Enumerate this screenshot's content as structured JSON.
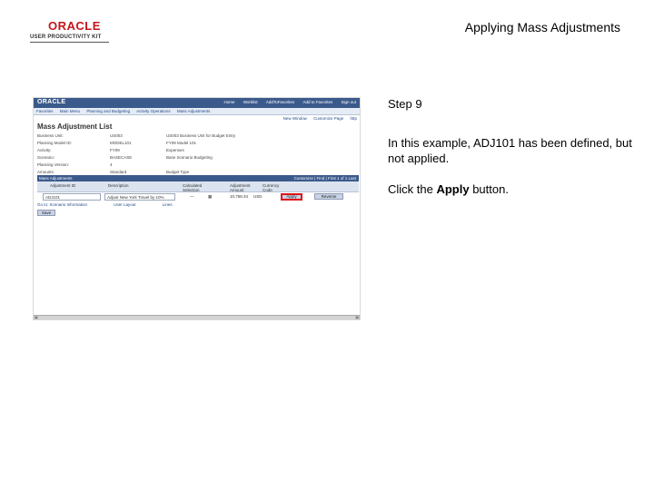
{
  "header": {
    "logo_oracle": "ORACLE",
    "logo_subtitle": "USER PRODUCTIVITY KIT",
    "title": "Applying Mass Adjustments"
  },
  "screenshot": {
    "app_logo": "ORACLE",
    "top_links": [
      "Home",
      "Worklist",
      "AddToFavorites",
      "Add to Favorites",
      "Sign out"
    ],
    "menu": [
      "Favorites",
      "Main Menu",
      "Planning and Budgeting",
      "Activity Operations",
      "Mass Adjustments"
    ],
    "toolbar": [
      "New Window",
      "Customize Page",
      "http"
    ],
    "page_title": "Mass Adjustment List",
    "fields": [
      {
        "label": "Business Unit:",
        "value": "US003",
        "desc": "US003 Business Unit for Budget Entry"
      },
      {
        "label": "Planning Model ID:",
        "value": "MODEL101",
        "desc": "FY09 Model 101"
      },
      {
        "label": "Activity:",
        "value": "FY09",
        "desc": "Expenses"
      },
      {
        "label": "Scenario:",
        "value": "BASECASE",
        "desc": "Base Scenario Budgeting"
      },
      {
        "label": "Planning Version:",
        "value": "4"
      },
      {
        "label": "Amounts:",
        "value": "Standard",
        "desc": "Budget Type"
      }
    ],
    "grid": {
      "header": "Mass Adjustments",
      "nav": "Customize | Find | First 1 of 1 Last",
      "columns": [
        "Adjustment ID",
        "Description",
        "Calculated Selection",
        "Adjustment Amount",
        "Currency Code"
      ],
      "row": {
        "id": "ADJ101",
        "description": "Adjust New York Travel by 10%",
        "selection": "—",
        "amount": "10,758.34",
        "currency": "USD",
        "apply_label": "Apply",
        "reverse_label": "Reverse"
      }
    },
    "bottom_links": [
      "Go to: Scenario Information",
      "User Layout",
      "Lines"
    ],
    "save_label": "Save"
  },
  "instructions": {
    "step": "Step 9",
    "text": "In this example, ADJ101 has been defined, but not applied.",
    "click_prefix": "Click the ",
    "click_target": "Apply",
    "click_suffix": " button."
  }
}
